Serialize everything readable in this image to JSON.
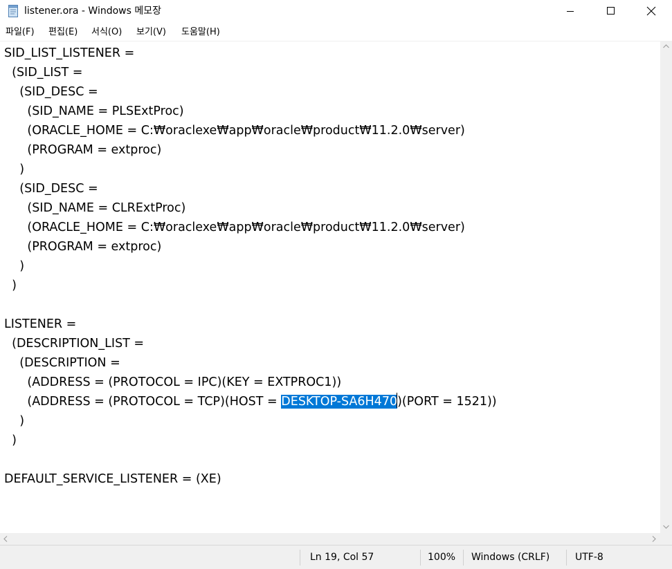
{
  "window": {
    "title": "listener.ora - Windows 메모장",
    "icon": "notepad-icon"
  },
  "menu": [
    "파일(F)",
    "편집(E)",
    "서식(O)",
    "보기(V)",
    "도움말(H)"
  ],
  "editor": {
    "lines": [
      "SID_LIST_LISTENER =",
      "  (SID_LIST =",
      "    (SID_DESC =",
      "      (SID_NAME = PLSExtProc)",
      "      (ORACLE_HOME = C:₩oraclexe₩app₩oracle₩product₩11.2.0₩server)",
      "      (PROGRAM = extproc)",
      "    )",
      "    (SID_DESC =",
      "      (SID_NAME = CLRExtProc)",
      "      (ORACLE_HOME = C:₩oraclexe₩app₩oracle₩product₩11.2.0₩server)",
      "      (PROGRAM = extproc)",
      "    )",
      "  )",
      "",
      "LISTENER =",
      "  (DESCRIPTION_LIST =",
      "    (DESCRIPTION =",
      "      (ADDRESS = (PROTOCOL = IPC)(KEY = EXTPROC1))",
      "      (ADDRESS = (PROTOCOL = TCP)(HOST = DESKTOP-SA6H470)(PORT = 1521))",
      "    )",
      "  )",
      "",
      "DEFAULT_SERVICE_LISTENER = (XE)"
    ],
    "selection": {
      "line": 19,
      "before": "      (ADDRESS = (PROTOCOL = TCP)(HOST = ",
      "selected": "DESKTOP-SA6H470",
      "after": ")(PORT = 1521))"
    }
  },
  "status": {
    "position": "Ln 19, Col 57",
    "zoom": "100%",
    "line_ending": "Windows (CRLF)",
    "encoding": "UTF-8"
  },
  "colors": {
    "selection": "#0078d7",
    "statusbar": "#f0f0f0"
  }
}
